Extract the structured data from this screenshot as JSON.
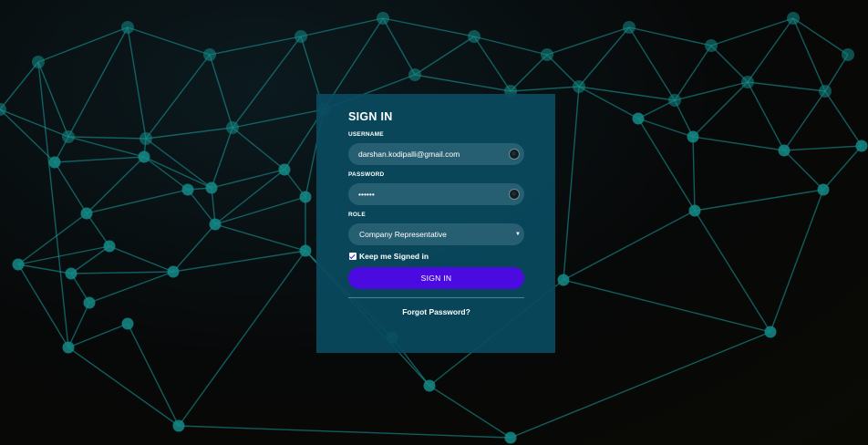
{
  "login": {
    "title": "SIGN IN",
    "username_label": "USERNAME",
    "username_value": "darshan.kodipalli@gmail.com",
    "password_label": "PASSWORD",
    "password_value": "••••••",
    "role_label": "ROLE",
    "role_value": "Company Representative",
    "keep_signed_in_label": "Keep me Signed in",
    "keep_signed_in_checked": true,
    "submit_label": "SIGN IN",
    "forgot_label": "Forgot Password?"
  },
  "colors": {
    "card_background": "#0a4a60",
    "button": "#4a0ae0",
    "network_lines": "#1aa3a3",
    "page_background": "#070808"
  },
  "icons": {
    "username_field": "eye-toggle-icon",
    "password_field": "eye-toggle-icon",
    "role_select": "caret-down-icon"
  }
}
